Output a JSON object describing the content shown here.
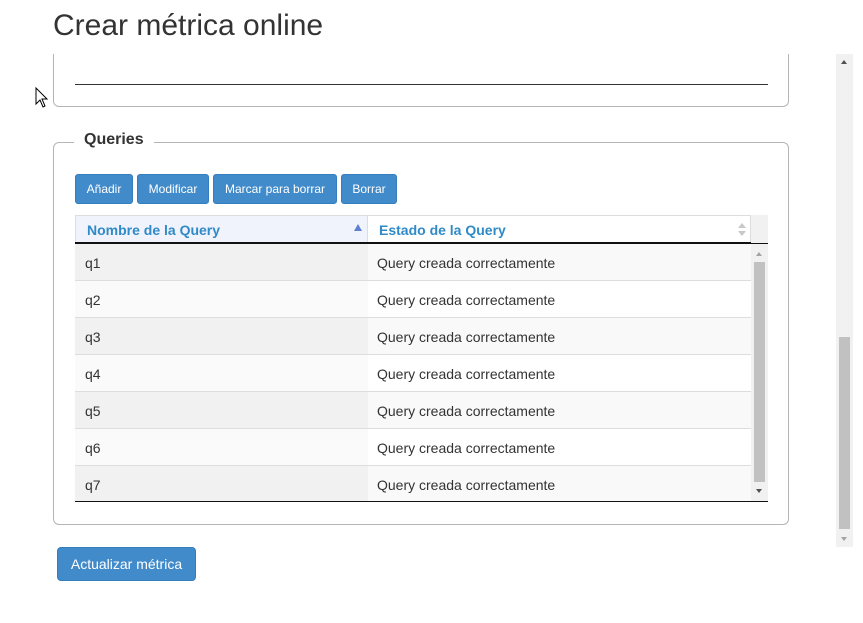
{
  "page": {
    "title": "Crear métrica online"
  },
  "queries_section": {
    "legend": "Queries",
    "buttons": {
      "add": "Añadir",
      "modify": "Modificar",
      "mark_delete": "Marcar para borrar",
      "delete": "Borrar"
    },
    "table": {
      "columns": [
        "Nombre de la Query",
        "Estado de la Query"
      ],
      "sorted_column": "Nombre de la Query",
      "sort_direction": "ascending",
      "rows": [
        {
          "name": "q1",
          "status": "Query creada correctamente"
        },
        {
          "name": "q2",
          "status": "Query creada correctamente"
        },
        {
          "name": "q3",
          "status": "Query creada correctamente"
        },
        {
          "name": "q4",
          "status": "Query creada correctamente"
        },
        {
          "name": "q5",
          "status": "Query creada correctamente"
        },
        {
          "name": "q6",
          "status": "Query creada correctamente"
        },
        {
          "name": "q7",
          "status": "Query creada correctamente"
        }
      ]
    }
  },
  "actions": {
    "update": "Actualizar métrica"
  },
  "colors": {
    "primary_button": "#428bca",
    "header_link": "#2f8ac7",
    "sort_indicator": "#5f7fd0"
  },
  "icons": {
    "cursor": "mouse-pointer-icon",
    "sort_asc": "sort-asc-icon",
    "sort_both": "sort-both-icon"
  }
}
